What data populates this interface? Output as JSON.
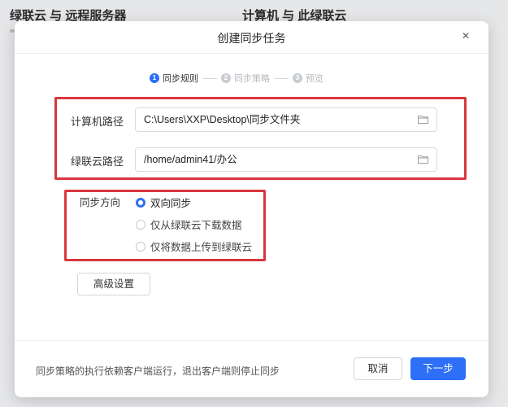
{
  "background": {
    "left_title": "绿联云 与 远程服务器",
    "right_title": "计算机 与 此绿联云"
  },
  "dialog": {
    "title": "创建同步任务",
    "close_glyph": "×"
  },
  "stepper": {
    "steps": [
      {
        "num": "1",
        "label": "同步规则",
        "state": "active"
      },
      {
        "num": "2",
        "label": "同步策略",
        "state": "inactive"
      },
      {
        "num": "3",
        "label": "预览",
        "state": "inactive"
      }
    ]
  },
  "paths": {
    "computer_label": "计算机路径",
    "computer_value": "C:\\Users\\XXP\\Desktop\\同步文件夹",
    "nas_label": "绿联云路径",
    "nas_value": "/home/admin41/办公"
  },
  "sync_direction": {
    "label": "同步方向",
    "options": [
      {
        "label": "双向同步",
        "checked": true
      },
      {
        "label": "仅从绿联云下载数据",
        "checked": false
      },
      {
        "label": "仅将数据上传到绿联云",
        "checked": false
      }
    ]
  },
  "advanced_button": "高级设置",
  "footer": {
    "note": "同步策略的执行依赖客户端运行，退出客户端则停止同步",
    "cancel_label": "取消",
    "next_label": "下一步"
  },
  "colors": {
    "accent": "#2d6ff7",
    "highlight_box": "#d9363e"
  },
  "icons": {
    "close": "close-icon",
    "folder": "folder-icon"
  }
}
